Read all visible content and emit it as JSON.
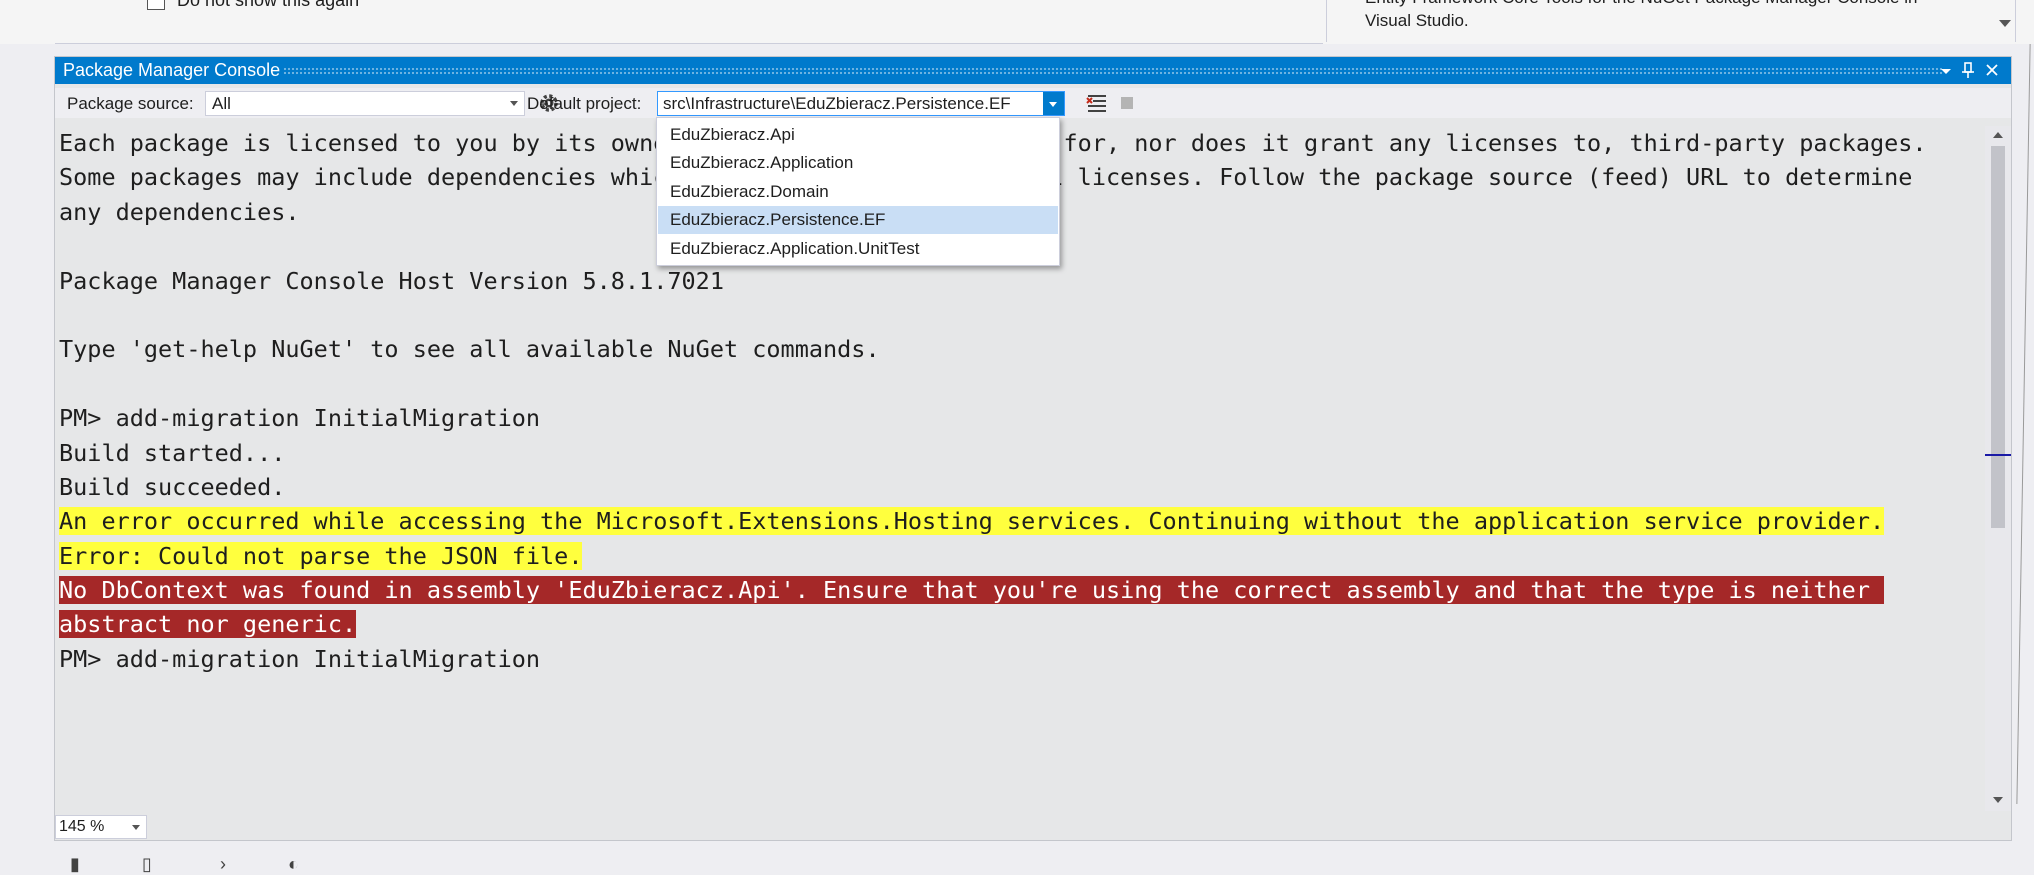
{
  "top_left": {
    "checkbox_label": "Do not show this again"
  },
  "top_right": {
    "line1": "Entity Framework Core Tools for the NuGet Package Manager Console in",
    "line2": "Visual Studio."
  },
  "window": {
    "title": "Package Manager Console",
    "buttons": [
      "chevron-down-icon",
      "pin-icon",
      "close-icon"
    ]
  },
  "toolbar": {
    "package_source_label": "Package source:",
    "package_source_value": "All",
    "default_project_label": "Default project:",
    "default_project_value": "src\\Infrastructure\\EduZbieracz.Persistence.EF",
    "icons": [
      "gear-icon",
      "clear-console-icon",
      "stop-icon"
    ]
  },
  "dropdown": {
    "items": [
      "EduZbieracz.Api",
      "EduZbieracz.Application",
      "EduZbieracz.Domain",
      "EduZbieracz.Persistence.EF",
      "EduZbieracz.Application.UnitTest"
    ],
    "selected_index": 3
  },
  "console": {
    "lines": [
      {
        "text": "Each package is licensed to you by its owner. NuGet is not responsible for, nor does it grant any licenses to, third-party packages.",
        "style": "normal"
      },
      {
        "text": "Some packages may include dependencies which are governed by additional licenses. Follow the package source (feed) URL to determine",
        "style": "normal"
      },
      {
        "text": "any dependencies.",
        "style": "normal"
      },
      {
        "text": "",
        "style": "normal"
      },
      {
        "text": "Package Manager Console Host Version 5.8.1.7021",
        "style": "normal"
      },
      {
        "text": "",
        "style": "normal"
      },
      {
        "text": "Type 'get-help NuGet' to see all available NuGet commands.",
        "style": "normal"
      },
      {
        "text": "",
        "style": "normal"
      },
      {
        "text": "PM> add-migration InitialMigration",
        "style": "normal"
      },
      {
        "text": "Build started...",
        "style": "normal"
      },
      {
        "text": "Build succeeded.",
        "style": "normal"
      },
      {
        "text": "An error occurred while accessing the Microsoft.Extensions.Hosting services. Continuing without the application service provider.",
        "style": "warning"
      },
      {
        "text": "Error: Could not parse the JSON file.",
        "style": "warning"
      },
      {
        "text": "No DbContext was found in assembly 'EduZbieracz.Api'. Ensure that you're using the correct assembly and that the type is neither ",
        "style": "error"
      },
      {
        "text": "abstract nor generic.",
        "style": "error"
      },
      {
        "text": "PM> add-migration InitialMigration",
        "style": "normal"
      }
    ]
  },
  "zoom": {
    "value": "145 %"
  },
  "colors": {
    "accent": "#007acc",
    "warning_bg": "#ffff3e",
    "error_bg": "#a52828",
    "console_bg": "#e6e7e8",
    "selected_item": "#c9def5"
  }
}
